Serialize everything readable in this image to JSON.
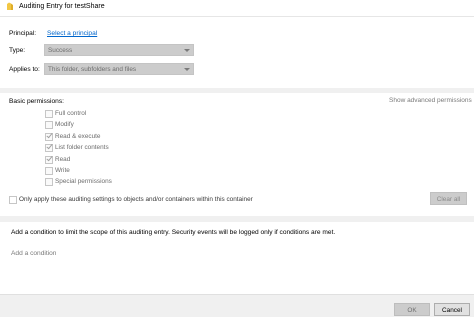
{
  "window": {
    "title": "Auditing Entry for testShare"
  },
  "principal": {
    "label": "Principal:",
    "link": "Select a principal"
  },
  "type": {
    "label": "Type:",
    "value": "Success"
  },
  "applies_to": {
    "label": "Applies to:",
    "value": "This folder, subfolders and files"
  },
  "permissions": {
    "heading": "Basic permissions:",
    "show_advanced": "Show advanced permissions",
    "items": [
      {
        "label": "Full control",
        "checked": false
      },
      {
        "label": "Modify",
        "checked": false
      },
      {
        "label": "Read & execute",
        "checked": true
      },
      {
        "label": "List folder contents",
        "checked": true
      },
      {
        "label": "Read",
        "checked": true
      },
      {
        "label": "Write",
        "checked": false
      },
      {
        "label": "Special permissions",
        "checked": false
      }
    ]
  },
  "apply_only": {
    "label": "Only apply these auditing settings to objects and/or containers within this container",
    "checked": false
  },
  "clear_all": "Clear all",
  "condition": {
    "description": "Add a condition to limit the scope of this auditing entry. Security events will be logged only if conditions are met.",
    "add_link": "Add a condition"
  },
  "footer": {
    "ok": "OK",
    "cancel": "Cancel"
  },
  "colors": {
    "link": "#0066cc",
    "disabled_fill": "#cccccc",
    "separator": "#f0f0f0",
    "folder_icon": "#f2c744"
  }
}
